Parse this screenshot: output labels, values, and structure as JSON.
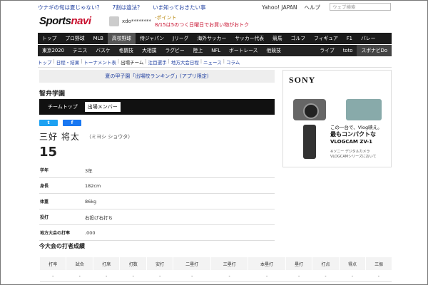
{
  "ticker": {
    "headline1": "ウナギの旬は夏じゃない？",
    "headline2": "7割は違法？",
    "headline3": "いま知っておきたい事",
    "yahoo": "Yahoo! JAPAN",
    "help": "ヘルプ",
    "search_placeholder": "ウェブ検索"
  },
  "header": {
    "logo_part1": "Sports",
    "logo_part2": "navi",
    "username": "xdo********",
    "points_label": "-ポイント",
    "promo": "8/15は5のつく日曜日でお買い物がおトク"
  },
  "nav1": [
    "トップ",
    "プロ野球",
    "MLB",
    "高校野球",
    "侍ジャパン",
    "Jリーグ",
    "海外サッカー",
    "サッカー代表",
    "競馬",
    "ゴルフ",
    "フィギュア",
    "F1",
    "バレー"
  ],
  "nav2_left": [
    "東京2020",
    "テニス",
    "バスケ",
    "格闘技",
    "大相撲",
    "ラグビー",
    "陸上",
    "NFL",
    "ボートレース",
    "他競技"
  ],
  "nav2_right": [
    "ライブ",
    "toto",
    "スポナビDo"
  ],
  "breadcrumb": [
    "トップ",
    "日程・結果",
    "トーナメント表",
    "出場チーム",
    "注目選手",
    "地方大会日程",
    "ニュース",
    "コラム"
  ],
  "banner": "夏の甲子園「出場校ランキング」(アプリ限定)",
  "school": "智弁学園",
  "tabs": [
    "チームトップ",
    "出場メンバー"
  ],
  "share": {
    "twitter": "t",
    "facebook": "f"
  },
  "player": {
    "name": "三好 将太",
    "kana": "（ミヨシ ショウタ）",
    "number": "15"
  },
  "profile": [
    {
      "k": "学年",
      "v": "3年"
    },
    {
      "k": "身長",
      "v": "182cm"
    },
    {
      "k": "体重",
      "v": "86kg"
    },
    {
      "k": "投打",
      "v": "右投げ右打ち"
    },
    {
      "k": "地方大会の打率",
      "v": ".000"
    }
  ],
  "stats_title": "今大会の打者成績",
  "stats_headers": [
    "打率",
    "試合",
    "打席",
    "打数",
    "安打",
    "二塁打",
    "三塁打",
    "本塁打",
    "塁打",
    "打点",
    "得点",
    "三振"
  ],
  "stats_values": [
    "-",
    "-",
    "-",
    "-",
    "-",
    "-",
    "-",
    "-",
    "-",
    "-",
    "-",
    "-"
  ],
  "ad": {
    "brand": "SONY",
    "copy1": "この一台で、Vlog映え。",
    "copy2": "最もコンパクトな",
    "copy3": "VLOGCAM ZV-1",
    "note1": "※ソニー デジタルカメラ",
    "note2": "VLOGCAMシリーズにおいて"
  }
}
